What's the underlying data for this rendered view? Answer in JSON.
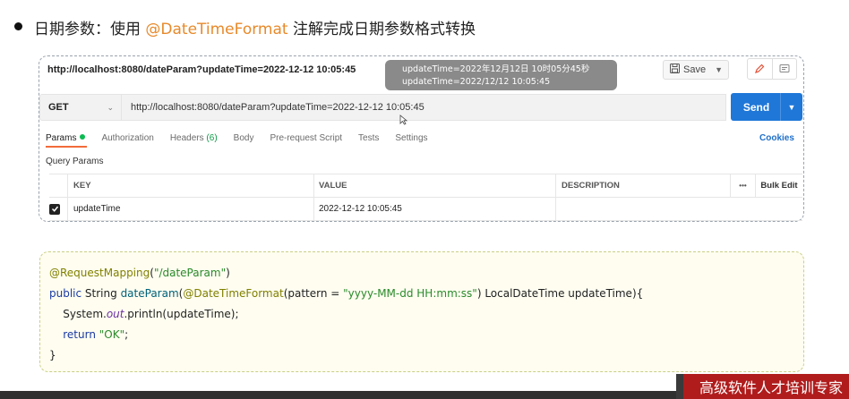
{
  "heading": {
    "prefix": "日期参数：使用 ",
    "accent": "@DateTimeFormat",
    "suffix": " 注解完成日期参数格式转换",
    "accent_color": "#e8892a"
  },
  "request": {
    "name": "http://localhost:8080/dateParam?updateTime=2022-12-12 10:05:45",
    "save_label": "Save",
    "method": "GET",
    "url": "http://localhost:8080/dateParam?updateTime=2022-12-12 10:05:45",
    "send_label": "Send",
    "send_color": "#1f77d8"
  },
  "tooltip": {
    "line1": "updateTime=2022年12月12日 10时05分45秒",
    "line2": "updateTime=2022/12/12 10:05:45"
  },
  "tabs": [
    {
      "label": "Params",
      "active": true,
      "dot": true
    },
    {
      "label": "Authorization"
    },
    {
      "label": "Headers",
      "count": "(6)"
    },
    {
      "label": "Body"
    },
    {
      "label": "Pre-request Script"
    },
    {
      "label": "Tests"
    },
    {
      "label": "Settings"
    }
  ],
  "cookies_label": "Cookies",
  "query_params": {
    "title": "Query Params",
    "columns": {
      "key": "KEY",
      "value": "VALUE",
      "description": "DESCRIPTION",
      "more": "•••",
      "bulk": "Bulk Edit"
    },
    "rows": [
      {
        "checked": true,
        "key": "updateTime",
        "value": "2022-12-12 10:05:45",
        "description": ""
      }
    ]
  },
  "code": {
    "line1_ann": "@RequestMapping",
    "line1_rest_a": "(",
    "line1_str": "\"/dateParam\"",
    "line1_rest_b": ")",
    "line2_kw1": "public",
    "line2_type": " String ",
    "line2_fn": "dateParam",
    "line2_open": "(",
    "line2_ann": "@DateTimeFormat",
    "line2_mid": "(pattern = ",
    "line2_str": "\"yyyy-MM-dd HH:mm:ss\"",
    "line2_end": ") LocalDateTime updateTime){",
    "line3_a": "    System.",
    "line3_it": "out",
    "line3_b": ".println(updateTime);",
    "line4_kw": "    return ",
    "line4_str": "\"OK\"",
    "line4_end": ";",
    "line5": "}"
  },
  "banner_text": "高级软件人才培训专家"
}
